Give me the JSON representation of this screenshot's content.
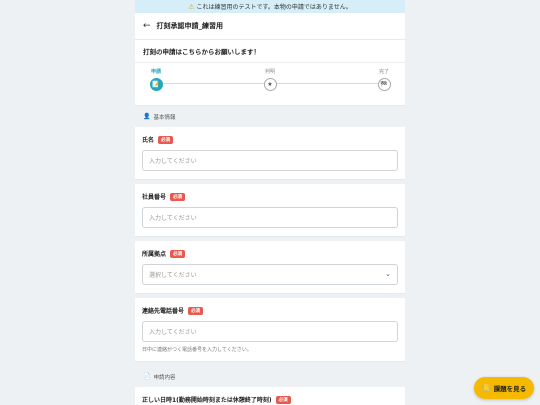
{
  "banner": {
    "text": "これは練習用のテストです。本物の申請ではありません。"
  },
  "header": {
    "title": "打刻承認申請_練習用"
  },
  "lead": {
    "text": "打刻の申請はこちらからお願いします！"
  },
  "steps": [
    {
      "label": "申請",
      "icon": "📝"
    },
    {
      "label": "判明",
      "icon": "★"
    },
    {
      "label": "完了",
      "icon": "🏁"
    }
  ],
  "sections": {
    "basic": "基本情報",
    "request": "申請内容"
  },
  "fields": {
    "name": {
      "label": "氏名",
      "placeholder": "入力してください"
    },
    "employee_id": {
      "label": "社員番号",
      "placeholder": "入力してください"
    },
    "office": {
      "label": "所属拠点",
      "placeholder": "選択してください"
    },
    "phone": {
      "label": "連絡先電話番号",
      "placeholder": "入力してください",
      "hint": "日中に連絡がつく電話番号を入力してください。"
    },
    "datetime": {
      "label": "正しい日時1(勤務開始時刻または休憩終了時刻)"
    }
  },
  "required_badge": "必須",
  "fab": {
    "label": "課題を見る"
  }
}
